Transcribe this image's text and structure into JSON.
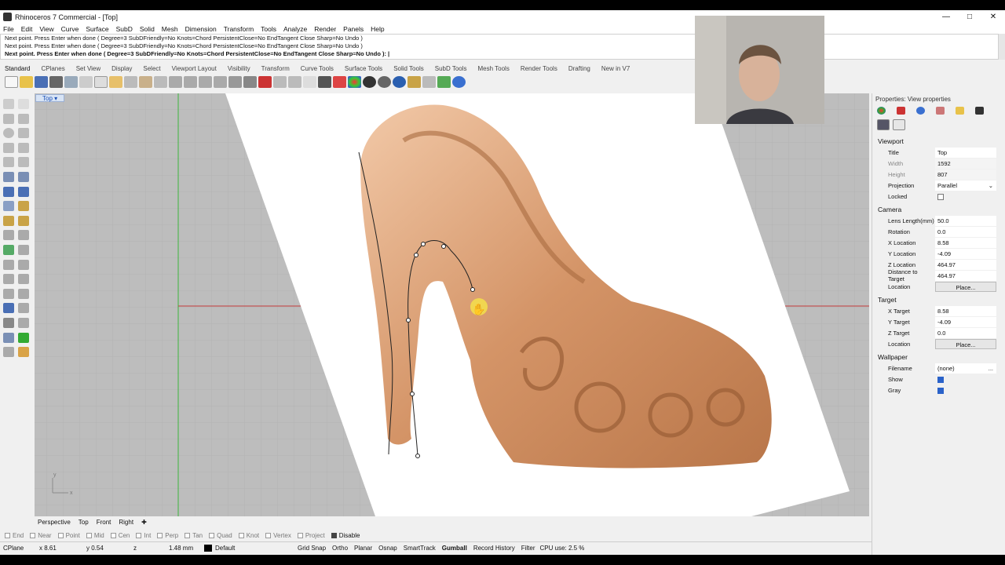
{
  "window": {
    "title": "Rhinoceros 7 Commercial - [Top]"
  },
  "menu": [
    "File",
    "Edit",
    "View",
    "Curve",
    "Surface",
    "SubD",
    "Solid",
    "Mesh",
    "Dimension",
    "Transform",
    "Tools",
    "Analyze",
    "Render",
    "Panels",
    "Help"
  ],
  "command_history": [
    "Next point. Press Enter when done ( Degree=3  SubDFriendly=No  Knots=Chord  PersistentClose=No  EndTangent  Close  Sharp=No  Undo )",
    "Next point. Press Enter when done ( Degree=3  SubDFriendly=No  Knots=Chord  PersistentClose=No  EndTangent  Close  Sharp=No  Undo )",
    "Next point. Press Enter when done ( Degree=3  SubDFriendly=No  Knots=Chord  PersistentClose=No  EndTangent  Close  Sharp=No  Undo ): |"
  ],
  "toolbar_tabs": [
    "Standard",
    "CPlanes",
    "Set View",
    "Display",
    "Select",
    "Viewport Layout",
    "Visibility",
    "Transform",
    "Curve Tools",
    "Surface Tools",
    "Solid Tools",
    "SubD Tools",
    "Mesh Tools",
    "Render Tools",
    "Drafting",
    "New in V7"
  ],
  "viewport": {
    "label": "Top",
    "axis_x": "x",
    "axis_y": "y"
  },
  "view_tabs": [
    "Perspective",
    "Top",
    "Front",
    "Right"
  ],
  "osnaps": [
    {
      "label": "End",
      "on": false
    },
    {
      "label": "Near",
      "on": false
    },
    {
      "label": "Point",
      "on": false
    },
    {
      "label": "Mid",
      "on": false
    },
    {
      "label": "Cen",
      "on": false
    },
    {
      "label": "Int",
      "on": false
    },
    {
      "label": "Perp",
      "on": false
    },
    {
      "label": "Tan",
      "on": false
    },
    {
      "label": "Quad",
      "on": false
    },
    {
      "label": "Knot",
      "on": false
    },
    {
      "label": "Vertex",
      "on": false
    },
    {
      "label": "Project",
      "on": false
    },
    {
      "label": "Disable",
      "on": true
    }
  ],
  "status": {
    "cplane": "CPlane",
    "x": "x 8.61",
    "y": "y 0.54",
    "z": "z",
    "dist": "1.48 mm",
    "layer": "Default",
    "toggles": [
      "Grid Snap",
      "Ortho",
      "Planar",
      "Osnap",
      "SmartTrack",
      "Gumball",
      "Record History",
      "Filter"
    ],
    "active_toggle": "Gumball",
    "cpu": "CPU use: 2.5 %"
  },
  "properties": {
    "title": "Properties: View properties",
    "viewport_section": "Viewport",
    "viewport_rows": [
      {
        "k": "Title",
        "v": "Top"
      },
      {
        "k": "Width",
        "v": "1592"
      },
      {
        "k": "Height",
        "v": "807"
      },
      {
        "k": "Projection",
        "v": "Parallel"
      }
    ],
    "locked_label": "Locked",
    "camera_section": "Camera",
    "camera_rows": [
      {
        "k": "Lens Length(mm)",
        "v": "50.0"
      },
      {
        "k": "Rotation",
        "v": "0.0"
      },
      {
        "k": "X Location",
        "v": "8.58"
      },
      {
        "k": "Y Location",
        "v": "-4.09"
      },
      {
        "k": "Z Location",
        "v": "464.97"
      },
      {
        "k": "Distance to Target",
        "v": "464.97"
      }
    ],
    "camera_location_label": "Location",
    "place_button": "Place...",
    "target_section": "Target",
    "target_rows": [
      {
        "k": "X Target",
        "v": "8.58"
      },
      {
        "k": "Y Target",
        "v": "-4.09"
      },
      {
        "k": "Z Target",
        "v": "0.0"
      }
    ],
    "target_location_label": "Location",
    "wallpaper_section": "Wallpaper",
    "filename_label": "Filename",
    "filename_value": "(none)",
    "show_label": "Show",
    "gray_label": "Gray"
  },
  "colors": {
    "accent": "#2a62c9",
    "shoe": "#d9a078",
    "grid": "#bdbdbd"
  }
}
